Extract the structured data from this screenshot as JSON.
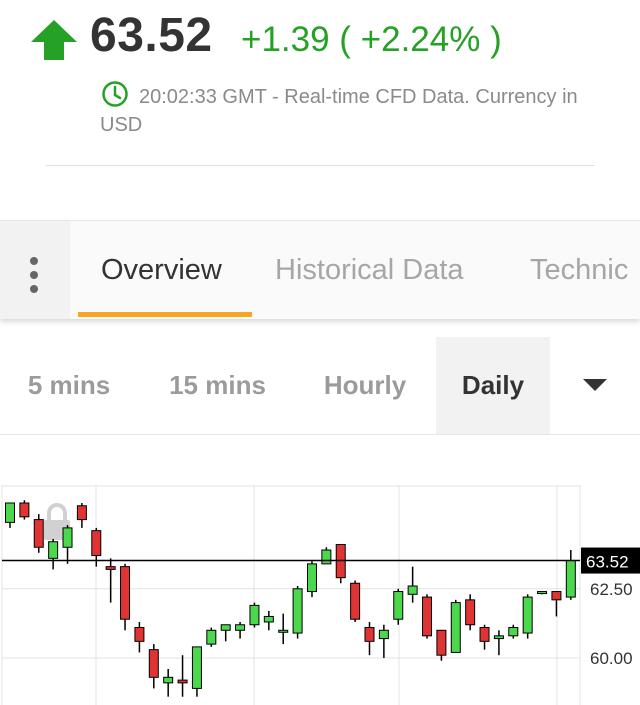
{
  "quote": {
    "direction_icon": "arrow-up-icon",
    "price": "63.52",
    "change": "+1.39 ( +2.24% )",
    "meta_text": "20:02:33 GMT - Real-time CFD Data. Currency in USD",
    "up_color": "#25a125"
  },
  "tabs": [
    {
      "label": "Overview",
      "active": true
    },
    {
      "label": "Historical Data",
      "active": false
    },
    {
      "label": "Technic",
      "active": false
    }
  ],
  "timeframes": [
    {
      "label": "5 mins",
      "active": false
    },
    {
      "label": "15 mins",
      "active": false
    },
    {
      "label": "Hourly",
      "active": false
    },
    {
      "label": "Daily",
      "active": true
    }
  ],
  "chart_data": {
    "type": "candlestick",
    "current_price": 63.52,
    "current_price_label": "63.52",
    "y_ticks": [
      62.5,
      60.0
    ],
    "y_tick_labels": [
      "62.50",
      "60.00"
    ],
    "ylim": [
      58.3,
      66.25
    ],
    "grid": true,
    "colors": {
      "up": "#4cd84c",
      "down": "#e03333",
      "price_tag": "#000000"
    },
    "candles": [
      {
        "o": 64.9,
        "h": 65.6,
        "l": 64.7,
        "c": 65.6
      },
      {
        "o": 65.6,
        "h": 65.7,
        "l": 65.0,
        "c": 65.1
      },
      {
        "o": 65.0,
        "h": 65.2,
        "l": 63.8,
        "c": 64.0
      },
      {
        "o": 63.6,
        "h": 64.3,
        "l": 63.2,
        "c": 64.2
      },
      {
        "o": 64.0,
        "h": 64.8,
        "l": 63.4,
        "c": 64.7
      },
      {
        "o": 65.5,
        "h": 65.6,
        "l": 64.7,
        "c": 65.0
      },
      {
        "o": 64.6,
        "h": 64.7,
        "l": 63.3,
        "c": 63.7
      },
      {
        "o": 63.3,
        "h": 63.6,
        "l": 62.0,
        "c": 63.2
      },
      {
        "o": 63.3,
        "h": 63.4,
        "l": 61.0,
        "c": 61.4
      },
      {
        "o": 61.1,
        "h": 61.3,
        "l": 60.2,
        "c": 60.6
      },
      {
        "o": 60.3,
        "h": 60.5,
        "l": 58.9,
        "c": 59.3
      },
      {
        "o": 59.1,
        "h": 59.6,
        "l": 58.6,
        "c": 59.3
      },
      {
        "o": 59.2,
        "h": 60.1,
        "l": 58.6,
        "c": 59.1
      },
      {
        "o": 58.9,
        "h": 60.4,
        "l": 58.6,
        "c": 60.4
      },
      {
        "o": 60.5,
        "h": 61.1,
        "l": 60.4,
        "c": 61.0
      },
      {
        "o": 61.0,
        "h": 61.2,
        "l": 60.6,
        "c": 61.2
      },
      {
        "o": 61.0,
        "h": 61.3,
        "l": 60.7,
        "c": 61.2
      },
      {
        "o": 61.2,
        "h": 62.0,
        "l": 61.1,
        "c": 61.9
      },
      {
        "o": 61.3,
        "h": 61.7,
        "l": 61.0,
        "c": 61.5
      },
      {
        "o": 61.0,
        "h": 61.6,
        "l": 60.5,
        "c": 61.0
      },
      {
        "o": 60.9,
        "h": 62.6,
        "l": 60.7,
        "c": 62.5
      },
      {
        "o": 62.4,
        "h": 63.5,
        "l": 62.2,
        "c": 63.4
      },
      {
        "o": 63.4,
        "h": 64.0,
        "l": 63.4,
        "c": 63.9
      },
      {
        "o": 64.1,
        "h": 64.1,
        "l": 62.7,
        "c": 62.9
      },
      {
        "o": 62.7,
        "h": 62.8,
        "l": 61.3,
        "c": 61.4
      },
      {
        "o": 61.1,
        "h": 61.3,
        "l": 60.1,
        "c": 60.6
      },
      {
        "o": 60.7,
        "h": 61.2,
        "l": 60.0,
        "c": 61.0
      },
      {
        "o": 61.4,
        "h": 62.5,
        "l": 61.2,
        "c": 62.4
      },
      {
        "o": 62.3,
        "h": 63.3,
        "l": 62.0,
        "c": 62.6
      },
      {
        "o": 62.2,
        "h": 62.3,
        "l": 60.7,
        "c": 60.8
      },
      {
        "o": 61.0,
        "h": 61.0,
        "l": 59.9,
        "c": 60.1
      },
      {
        "o": 60.2,
        "h": 62.1,
        "l": 60.2,
        "c": 62.0
      },
      {
        "o": 62.1,
        "h": 62.3,
        "l": 61.0,
        "c": 61.2
      },
      {
        "o": 61.1,
        "h": 61.2,
        "l": 60.3,
        "c": 60.6
      },
      {
        "o": 60.7,
        "h": 61.0,
        "l": 60.1,
        "c": 60.8
      },
      {
        "o": 60.8,
        "h": 61.2,
        "l": 60.7,
        "c": 61.1
      },
      {
        "o": 60.9,
        "h": 62.3,
        "l": 60.7,
        "c": 62.2
      },
      {
        "o": 62.4,
        "h": 62.4,
        "l": 62.3,
        "c": 62.4
      },
      {
        "o": 62.4,
        "h": 62.4,
        "l": 61.5,
        "c": 62.1
      },
      {
        "o": 62.2,
        "h": 63.9,
        "l": 62.1,
        "c": 63.52
      }
    ]
  }
}
